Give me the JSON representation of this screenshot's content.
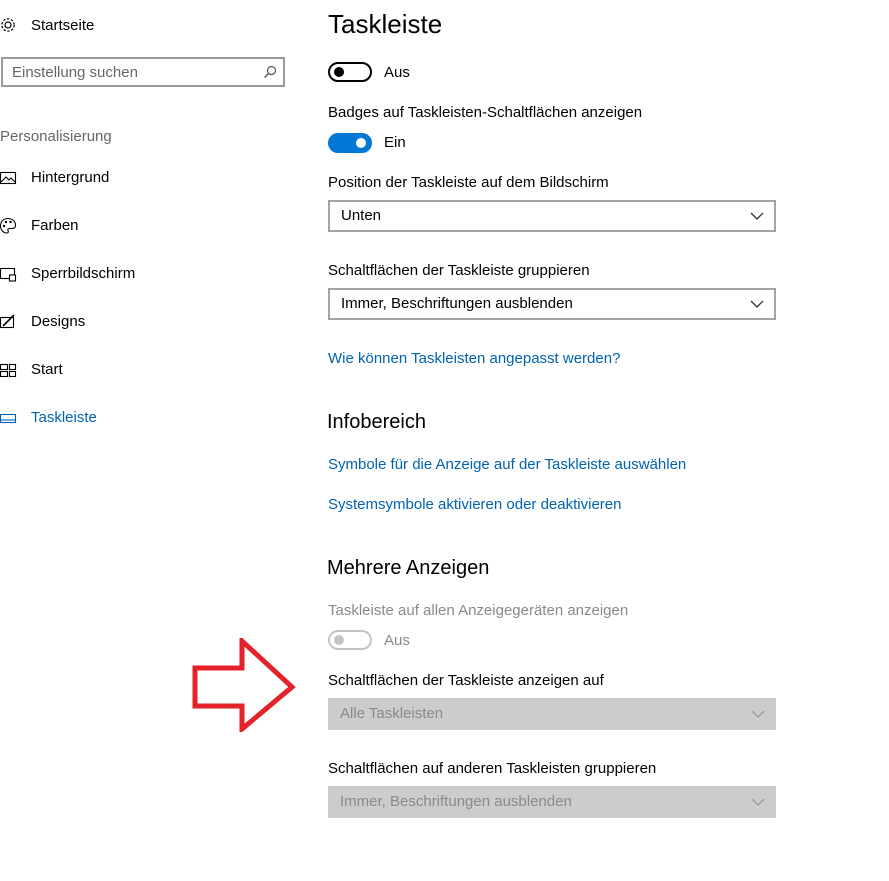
{
  "sidebar": {
    "home_label": "Startseite",
    "search_placeholder": "Einstellung suchen",
    "section": "Personalisierung",
    "items": [
      {
        "label": "Hintergrund",
        "icon": "picture-icon"
      },
      {
        "label": "Farben",
        "icon": "palette-icon"
      },
      {
        "label": "Sperrbildschirm",
        "icon": "lock-screen-icon"
      },
      {
        "label": "Designs",
        "icon": "themes-icon"
      },
      {
        "label": "Start",
        "icon": "start-tiles-icon"
      },
      {
        "label": "Taskleiste",
        "icon": "taskbar-icon",
        "active": true
      }
    ]
  },
  "main": {
    "title": "Taskleiste",
    "toggle1": {
      "state": "Aus"
    },
    "badges": {
      "label": "Badges auf Taskleisten-Schaltflächen anzeigen",
      "state": "Ein"
    },
    "position": {
      "label": "Position der Taskleiste auf dem Bildschirm",
      "value": "Unten"
    },
    "group": {
      "label": "Schaltflächen der Taskleiste gruppieren",
      "value": "Immer, Beschriftungen ausblenden"
    },
    "help_link": "Wie können Taskleisten angepasst werden?",
    "notification_area": {
      "heading": "Infobereich",
      "link1": "Symbole für die Anzeige auf der Taskleiste auswählen",
      "link2": "Systemsymbole aktivieren oder deaktivieren"
    },
    "multiple_displays": {
      "heading": "Mehrere Anzeigen",
      "show_all_label": "Taskleiste auf allen Anzeigegeräten anzeigen",
      "show_all_state": "Aus",
      "show_buttons_label": "Schaltflächen der Taskleiste anzeigen auf",
      "show_buttons_value": "Alle Taskleisten",
      "group_other_label": "Schaltflächen auf anderen Taskleisten gruppieren",
      "group_other_value": "Immer, Beschriftungen ausblenden"
    }
  },
  "colors": {
    "accent": "#0078d7",
    "link": "#0063b1",
    "annotation_arrow": "#e3222a",
    "disabled_text": "#8a8a8a",
    "disabled_field": "#cccccc"
  }
}
